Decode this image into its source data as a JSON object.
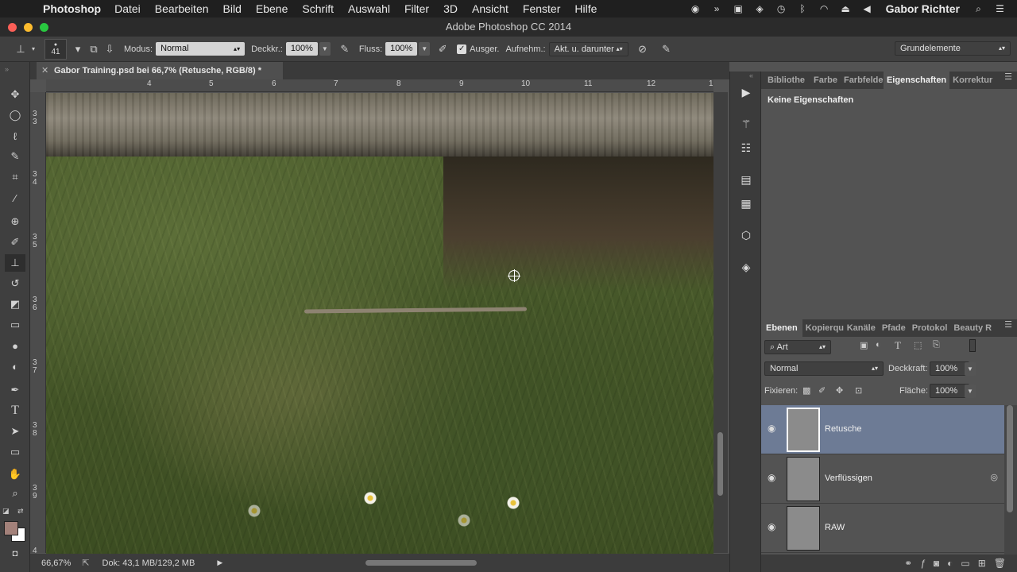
{
  "menubar": {
    "app": "Photoshop",
    "items": [
      "Datei",
      "Bearbeiten",
      "Bild",
      "Ebene",
      "Schrift",
      "Auswahl",
      "Filter",
      "3D",
      "Ansicht",
      "Fenster",
      "Hilfe"
    ],
    "user": "Gabor Richter"
  },
  "window": {
    "title": "Adobe Photoshop CC 2014"
  },
  "options": {
    "brush_size": "41",
    "mode_label": "Modus:",
    "mode_value": "Normal",
    "opacity_label": "Deckkr.:",
    "opacity_value": "100%",
    "flow_label": "Fluss:",
    "flow_value": "100%",
    "aligned_label": "Ausger.",
    "sample_label": "Aufnehm.:",
    "sample_value": "Akt. u. darunter",
    "workspace": "Grundelemente"
  },
  "document": {
    "tab_title": "Gabor Training.psd bei 66,7% (Retusche, RGB/8) *",
    "zoom": "66,67%",
    "doc_info": "Dok: 43,1 MB/129,2 MB"
  },
  "ruler": {
    "h_labels": [
      "4",
      "5",
      "6",
      "7",
      "8",
      "9",
      "10",
      "11",
      "12",
      "1"
    ],
    "v_labels": [
      "3",
      "3",
      "3",
      "4",
      "3",
      "5",
      "3",
      "6",
      "3",
      "7",
      "3",
      "8",
      "3",
      "9",
      "4"
    ]
  },
  "properties_panel": {
    "tabs": [
      "Bibliothe",
      "Farbe",
      "Farbfelde",
      "Eigenschaften",
      "Korrektur"
    ],
    "active_tab": "Eigenschaften",
    "empty_text": "Keine Eigenschaften"
  },
  "layers_panel": {
    "tabs": [
      "Ebenen",
      "Kopierqu",
      "Kanäle",
      "Pfade",
      "Protokol",
      "Beauty R"
    ],
    "active_tab": "Ebenen",
    "filter_label": "Art",
    "blend_mode": "Normal",
    "opacity_label": "Deckkraft:",
    "opacity_value": "100%",
    "lock_label": "Fixieren:",
    "fill_label": "Fläche:",
    "fill_value": "100%",
    "layers": [
      {
        "name": "Retusche",
        "selected": true
      },
      {
        "name": "Verflüssigen",
        "selected": false
      },
      {
        "name": "RAW",
        "selected": false
      }
    ]
  },
  "colors": {
    "selection": "#6d7b95",
    "foreground_swatch": "#a3817a",
    "background_swatch": "#ffffff"
  },
  "icons": {
    "tools": [
      "move-icon",
      "ellipse-marquee-icon",
      "lasso-icon",
      "quick-select-icon",
      "crop-icon",
      "eyedropper-icon",
      "healing-brush-icon",
      "brush-icon",
      "clone-stamp-icon",
      "history-brush-icon",
      "eraser-icon",
      "gradient-icon",
      "blur-icon",
      "dodge-icon",
      "pen-icon",
      "type-icon",
      "path-select-icon",
      "rectangle-icon",
      "hand-icon",
      "zoom-icon"
    ]
  }
}
